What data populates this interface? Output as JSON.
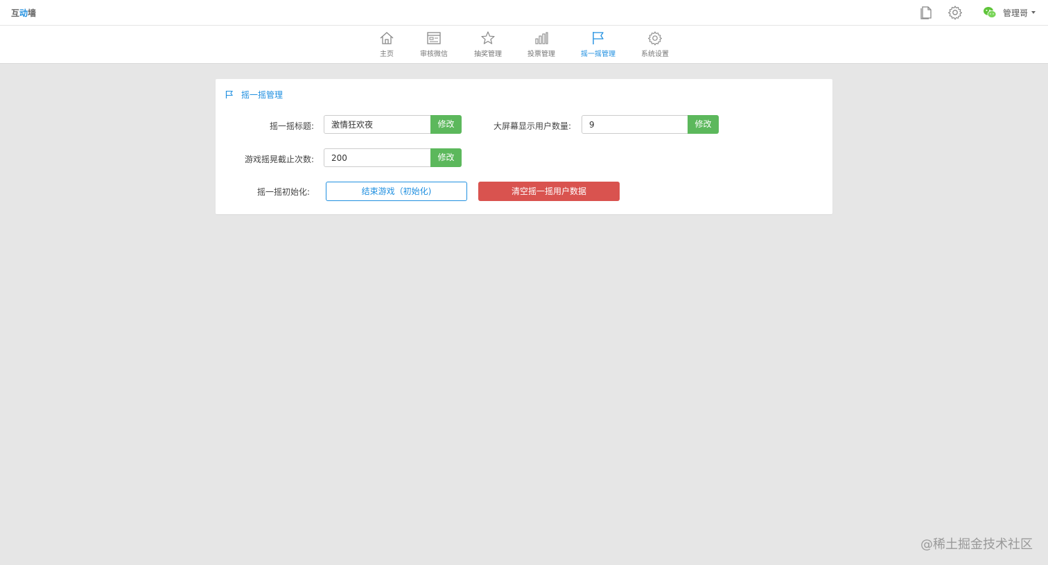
{
  "header": {
    "logo_prefix": "互",
    "logo_accent": "动",
    "logo_suffix": "墙",
    "user_name": "管理哥"
  },
  "nav": {
    "items": [
      {
        "label": "主页",
        "icon": "home-icon"
      },
      {
        "label": "审核微信",
        "icon": "review-icon"
      },
      {
        "label": "抽奖管理",
        "icon": "star-icon"
      },
      {
        "label": "投票管理",
        "icon": "bar-chart-icon"
      },
      {
        "label": "摇一摇管理",
        "icon": "flag-icon",
        "active": true
      },
      {
        "label": "系统设置",
        "icon": "gear-icon"
      }
    ]
  },
  "panel": {
    "title": "摇一摇管理",
    "shake_title_label": "摇一摇标题:",
    "shake_title_value": "激情狂欢夜",
    "screen_users_label": "大屏幕显示用户数量:",
    "screen_users_value": "9",
    "stop_count_label": "游戏摇晃截止次数:",
    "stop_count_value": "200",
    "modify_label": "修改",
    "init_label": "摇一摇初始化:",
    "end_game_label": "结束游戏（初始化)",
    "clear_data_label": "清空摇一摇用户数据"
  },
  "watermark": "@稀土掘金技术社区",
  "colors": {
    "accent": "#1f8fe0",
    "success": "#5cb85c",
    "danger": "#d9534f",
    "background": "#e6e6e6"
  }
}
